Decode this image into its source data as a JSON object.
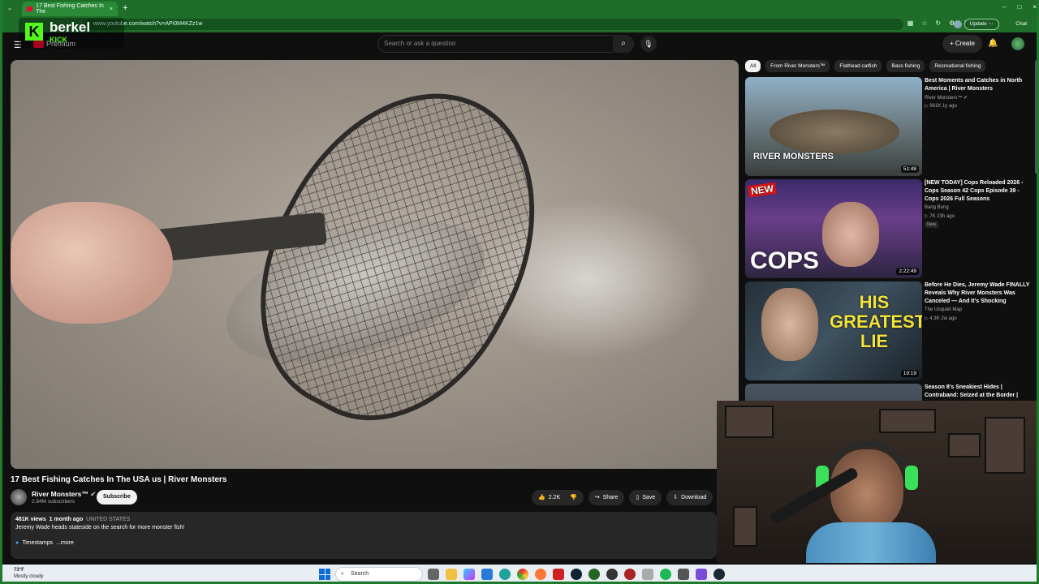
{
  "browser": {
    "tab_title": "17 Best Fishing Catches In The",
    "tab_close": "×",
    "new_tab": "+",
    "url": "www.youtube.com/watch?v=APi0M4KZz1w",
    "update_label": "Update",
    "chat_label": "Chat",
    "win_min": "–",
    "win_max": "□",
    "win_close": "×"
  },
  "overlay": {
    "logo_letter": "K",
    "streamer": "berkel",
    "platform": "KICK",
    "accent": "#53fc18"
  },
  "youtube": {
    "logo_text": "Premium",
    "search_placeholder": "Search or ask a question",
    "create_label": "Create"
  },
  "video": {
    "title": "17 Best Fishing Catches In The USA us | River Monsters",
    "channel": "River Monsters™",
    "subscribers": "2.84M subscribers",
    "subscribe_label": "Subscribe",
    "likes": "2.2K",
    "share_label": "Share",
    "save_label": "Save",
    "download_label": "Download",
    "views": "481K views",
    "age": "1 month ago",
    "location": "UNITED STATES",
    "description": "Jeremy Wade heads stateside on the search for more monster fish!",
    "timestamps_label": "Timestamps",
    "more_label": "...more"
  },
  "chips": [
    "All",
    "From River Monsters™",
    "Flathead catfish",
    "Bass fishing",
    "Recreational fishing"
  ],
  "recommendations": [
    {
      "title": "Best Moments and Catches in North America | River Monsters",
      "channel": "River Monsters™",
      "meta": "961K  1y ago",
      "duration": "51:48",
      "thumb_text": "RIVER MONSTERS",
      "badge": ""
    },
    {
      "title": "[NEW TODAY] Cops Reloaded 2026 - Cops Season 42 Cops Episode 39 - Cops 2026 Full Seasons",
      "channel": "Bang Bung",
      "meta": "7K  23h ago",
      "duration": "2:22:49",
      "thumb_text": "COPS",
      "badge": "New"
    },
    {
      "title": "Before He Dies, Jeremy Wade FINALLY Reveals Why River Monsters Was Canceled — And It's Shocking",
      "channel": "The Unquiet Map",
      "meta": "4.3K  2w ago",
      "duration": "19:19",
      "thumb_text": "HIS GREATEST LIE",
      "badge": ""
    },
    {
      "title": "Season 8's Sneakiest Hides | Contraband: Seized at the Border |",
      "channel": "",
      "meta": "",
      "duration": "",
      "thumb_text": "",
      "badge": ""
    }
  ],
  "taskbar": {
    "temp": "73°F",
    "weather": "Mostly cloudy",
    "search_label": "Search"
  }
}
